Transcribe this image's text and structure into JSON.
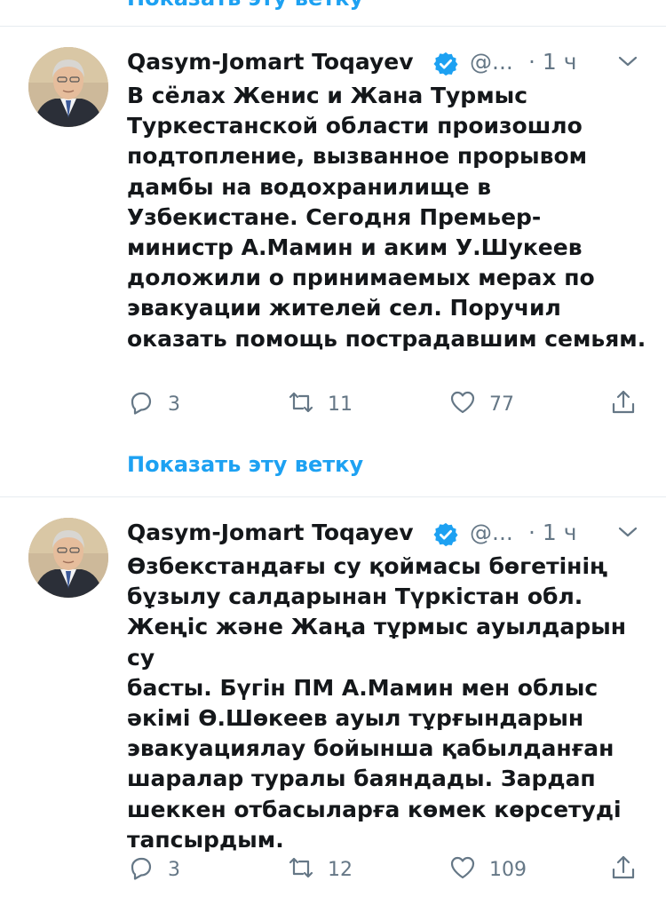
{
  "top_link": {
    "label": "Показать эту ветку"
  },
  "tweets": [
    {
      "author_name": "Qasym-Jomart Toqayev",
      "handle": "@...",
      "time": "· 1 ч",
      "text": "В сёлах Женис и Жана Турмыс\nТуркестанской области произошло\nподтопление, вызванное прорывом\nдамбы на водохранилище в\nУзбекистане. Сегодня Премьер-\nминистр А.Мамин и аким У.Шукеев\nдоложили о принимаемых мерах по\nэвакуации жителей сел. Поручил\nоказать помощь пострадавшим семьям.",
      "replies": "3",
      "retweets": "11",
      "likes": "77",
      "show_thread": "Показать эту ветку"
    },
    {
      "author_name": "Qasym-Jomart Toqayev",
      "handle": "@...",
      "time": "· 1 ч",
      "text": "Өзбекстандағы су қоймасы бөгетінің\nбұзылу салдарынан Түркістан обл.\nЖеңіс және Жаңа тұрмыс ауылдарын су\nбасты. Бүгін ПМ А.Мамин мен облыс\nәкімі Ө.Шөкеев ауыл тұрғындарын\nэвакуациялау бойынша қабылданған\nшаралар туралы баяндады. Зардап\nшеккен отбасыларға көмек көрсетуді\nтапсырдым.",
      "replies": "3",
      "retweets": "12",
      "likes": "109"
    }
  ],
  "colors": {
    "accent": "#1da1f2",
    "text": "#14171a",
    "secondary": "#657786",
    "divider": "#e6ecf0"
  },
  "icons": [
    "verified-icon",
    "chevron-down-icon",
    "reply-icon",
    "retweet-icon",
    "like-icon",
    "share-icon"
  ]
}
